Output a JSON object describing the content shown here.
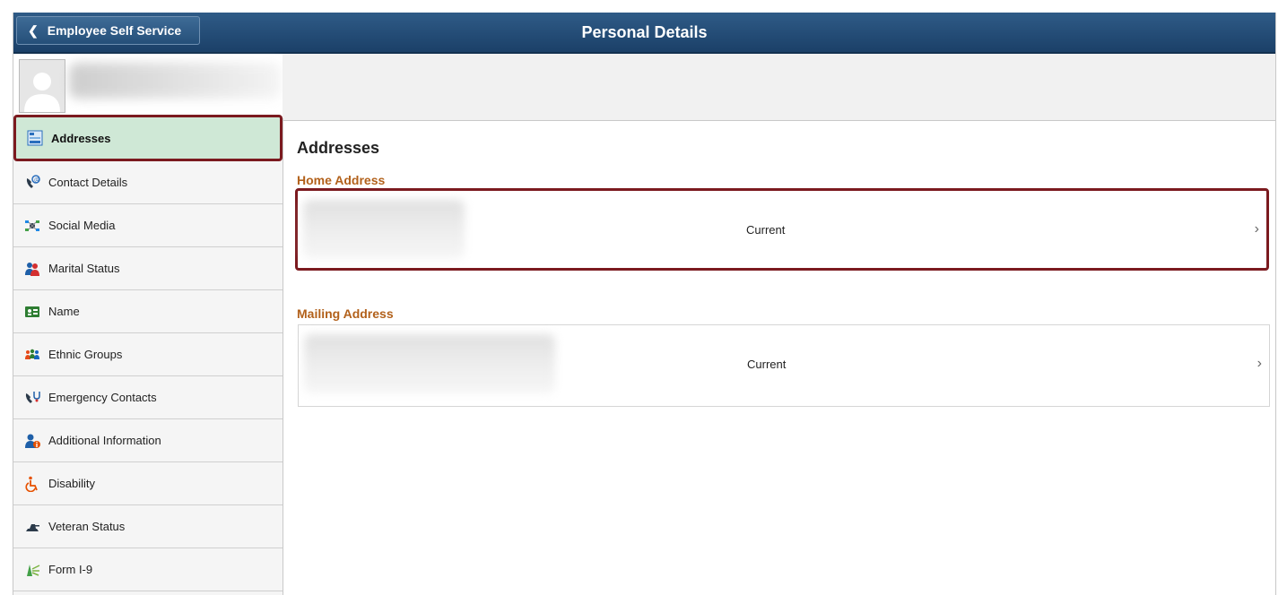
{
  "header": {
    "back_label": "Employee Self Service",
    "title": "Personal Details"
  },
  "sidebar": {
    "items": [
      {
        "label": "Addresses",
        "icon": "addresses-icon"
      },
      {
        "label": "Contact Details",
        "icon": "contact-details-icon"
      },
      {
        "label": "Social Media",
        "icon": "social-media-icon"
      },
      {
        "label": "Marital Status",
        "icon": "marital-status-icon"
      },
      {
        "label": "Name",
        "icon": "name-card-icon"
      },
      {
        "label": "Ethnic Groups",
        "icon": "ethnic-groups-icon"
      },
      {
        "label": "Emergency Contacts",
        "icon": "emergency-contacts-icon"
      },
      {
        "label": "Additional Information",
        "icon": "additional-information-icon"
      },
      {
        "label": "Disability",
        "icon": "wheelchair-icon"
      },
      {
        "label": "Veteran Status",
        "icon": "veteran-status-icon"
      },
      {
        "label": "Form I-9",
        "icon": "form-i9-icon"
      }
    ]
  },
  "main": {
    "title": "Addresses",
    "groups": [
      {
        "label": "Home Address",
        "status": "Current"
      },
      {
        "label": "Mailing Address",
        "status": "Current"
      }
    ]
  },
  "colors": {
    "header": "#1f4a75",
    "accent_orange": "#b2611b",
    "highlight_border": "#7b1a1f",
    "active_nav_bg": "#cfe8d6"
  }
}
